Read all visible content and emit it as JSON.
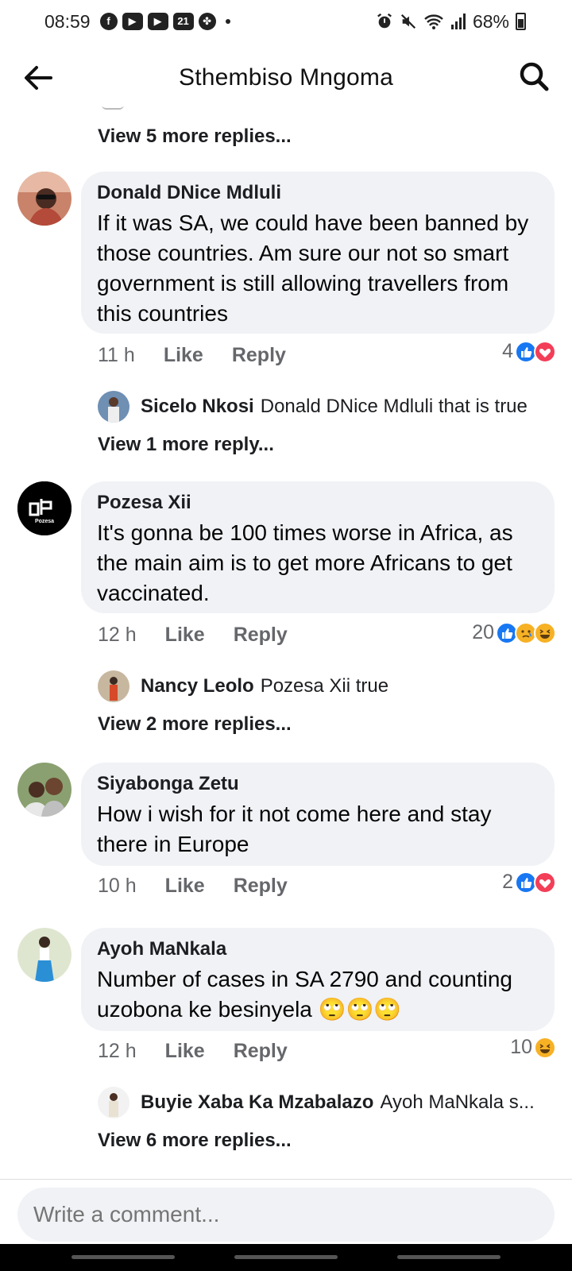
{
  "status_bar": {
    "time": "08:59",
    "battery": "68%",
    "left_icons": [
      "facebook-icon",
      "youtube-icon",
      "youtube-icon",
      "calendar-icon",
      "pinwheel-icon"
    ],
    "calendar_day": "21",
    "right_icons": [
      "alarm-icon",
      "mute-icon",
      "wifi-icon",
      "signal-icon",
      "battery-icon"
    ]
  },
  "header": {
    "title": "Sthembiso Mngoma",
    "back_icon": "back-arrow-icon",
    "search_icon": "search-icon"
  },
  "top_view_more": "View 5 more replies...",
  "comments": [
    {
      "name": "Donald DNice Mdluli",
      "text": "If it was SA, we could have been banned by those countries. Am sure our not  so smart government is still allowing travellers from this countries",
      "time": "11 h",
      "like": "Like",
      "reply": "Reply",
      "reaction_count": "4",
      "reactions": [
        "like",
        "love"
      ],
      "reply_preview": {
        "name": "Sicelo Nkosi",
        "text": "Donald DNice Mdluli that is true"
      },
      "view_more": "View 1 more reply..."
    },
    {
      "name": "Pozesa Xii",
      "avatar_text": "Pozesa",
      "text": "It's gonna be 100 times worse in Africa, as the  main aim is to get more Africans to get vaccinated.",
      "time": "12 h",
      "like": "Like",
      "reply": "Reply",
      "reaction_count": "20",
      "reactions": [
        "like",
        "sad",
        "haha"
      ],
      "reply_preview": {
        "name": "Nancy Leolo",
        "text": "Pozesa Xii true"
      },
      "view_more": "View 2 more replies..."
    },
    {
      "name": "Siyabonga Zetu",
      "text": "How i wish for it not come here and stay there in Europe",
      "time": "10 h",
      "like": "Like",
      "reply": "Reply",
      "reaction_count": "2",
      "reactions": [
        "like",
        "love"
      ]
    },
    {
      "name": "Ayoh MaNkala",
      "text": "Number of cases in SA 2790 and counting uzobona ke besinyela 🙄🙄🙄",
      "time": "12 h",
      "like": "Like",
      "reply": "Reply",
      "reaction_count": "10",
      "reactions": [
        "haha"
      ],
      "reply_preview": {
        "name": "Buyie Xaba Ka Mzabalazo",
        "text": "Ayoh MaNkala s..."
      },
      "view_more": "View 6 more replies..."
    }
  ],
  "composer": {
    "placeholder": "Write a comment..."
  },
  "colors": {
    "like_blue": "#1877f2",
    "love_red": "#f33e58",
    "haha_yellow": "#f7b125",
    "bubble_bg": "#f0f2f5"
  }
}
